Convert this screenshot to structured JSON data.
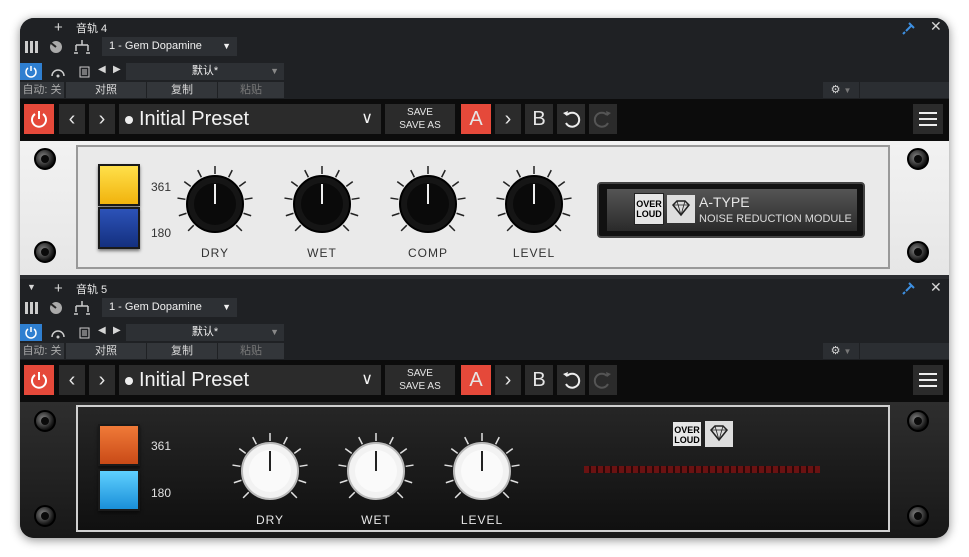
{
  "tracks": [
    {
      "track_name": "音轨 4",
      "plugin_name": "1 - Gem Dopamine",
      "preset_default": "默认*",
      "auto_label": "自动: 关",
      "compare_label": "对照",
      "copy_label": "复制",
      "paste_label": "粘贴",
      "preset": "Initial Preset",
      "save_label": "SAVE",
      "save_as_label": "SAVE AS",
      "a_label": "A",
      "b_label": "B",
      "num_top": "361",
      "num_bottom": "180",
      "knobs": [
        "DRY",
        "WET",
        "COMP",
        "LEVEL"
      ],
      "display_brand_top": "OVER",
      "display_brand_bottom": "LOUD",
      "display_title": "A-TYPE",
      "display_subtitle": "NOISE REDUCTION MODULE",
      "theme": "light",
      "button_colors": [
        "#f5c21a",
        "#1e3f9a"
      ]
    },
    {
      "track_name": "音轨 5",
      "plugin_name": "1 - Gem Dopamine",
      "preset_default": "默认*",
      "auto_label": "自动: 关",
      "compare_label": "对照",
      "copy_label": "复制",
      "paste_label": "粘贴",
      "preset": "Initial Preset",
      "save_label": "SAVE",
      "save_as_label": "SAVE AS",
      "a_label": "A",
      "b_label": "B",
      "num_top": "361",
      "num_bottom": "180",
      "knobs": [
        "DRY",
        "WET",
        "LEVEL"
      ],
      "display_brand_top": "OVER",
      "display_brand_bottom": "LOUD",
      "theme": "dark",
      "button_colors": [
        "#e0662a",
        "#27a8e0"
      ]
    }
  ],
  "icons": {
    "add": "+",
    "pin": "pin-icon",
    "close": "✕",
    "power": "power-icon",
    "prev": "‹",
    "next": "›",
    "undo": "undo-icon",
    "redo": "redo-icon",
    "menu": "hamburger-icon",
    "gear": "gear-icon"
  },
  "colors": {
    "accent_red": "#e5493a",
    "host_blue": "#2f7fd0"
  }
}
